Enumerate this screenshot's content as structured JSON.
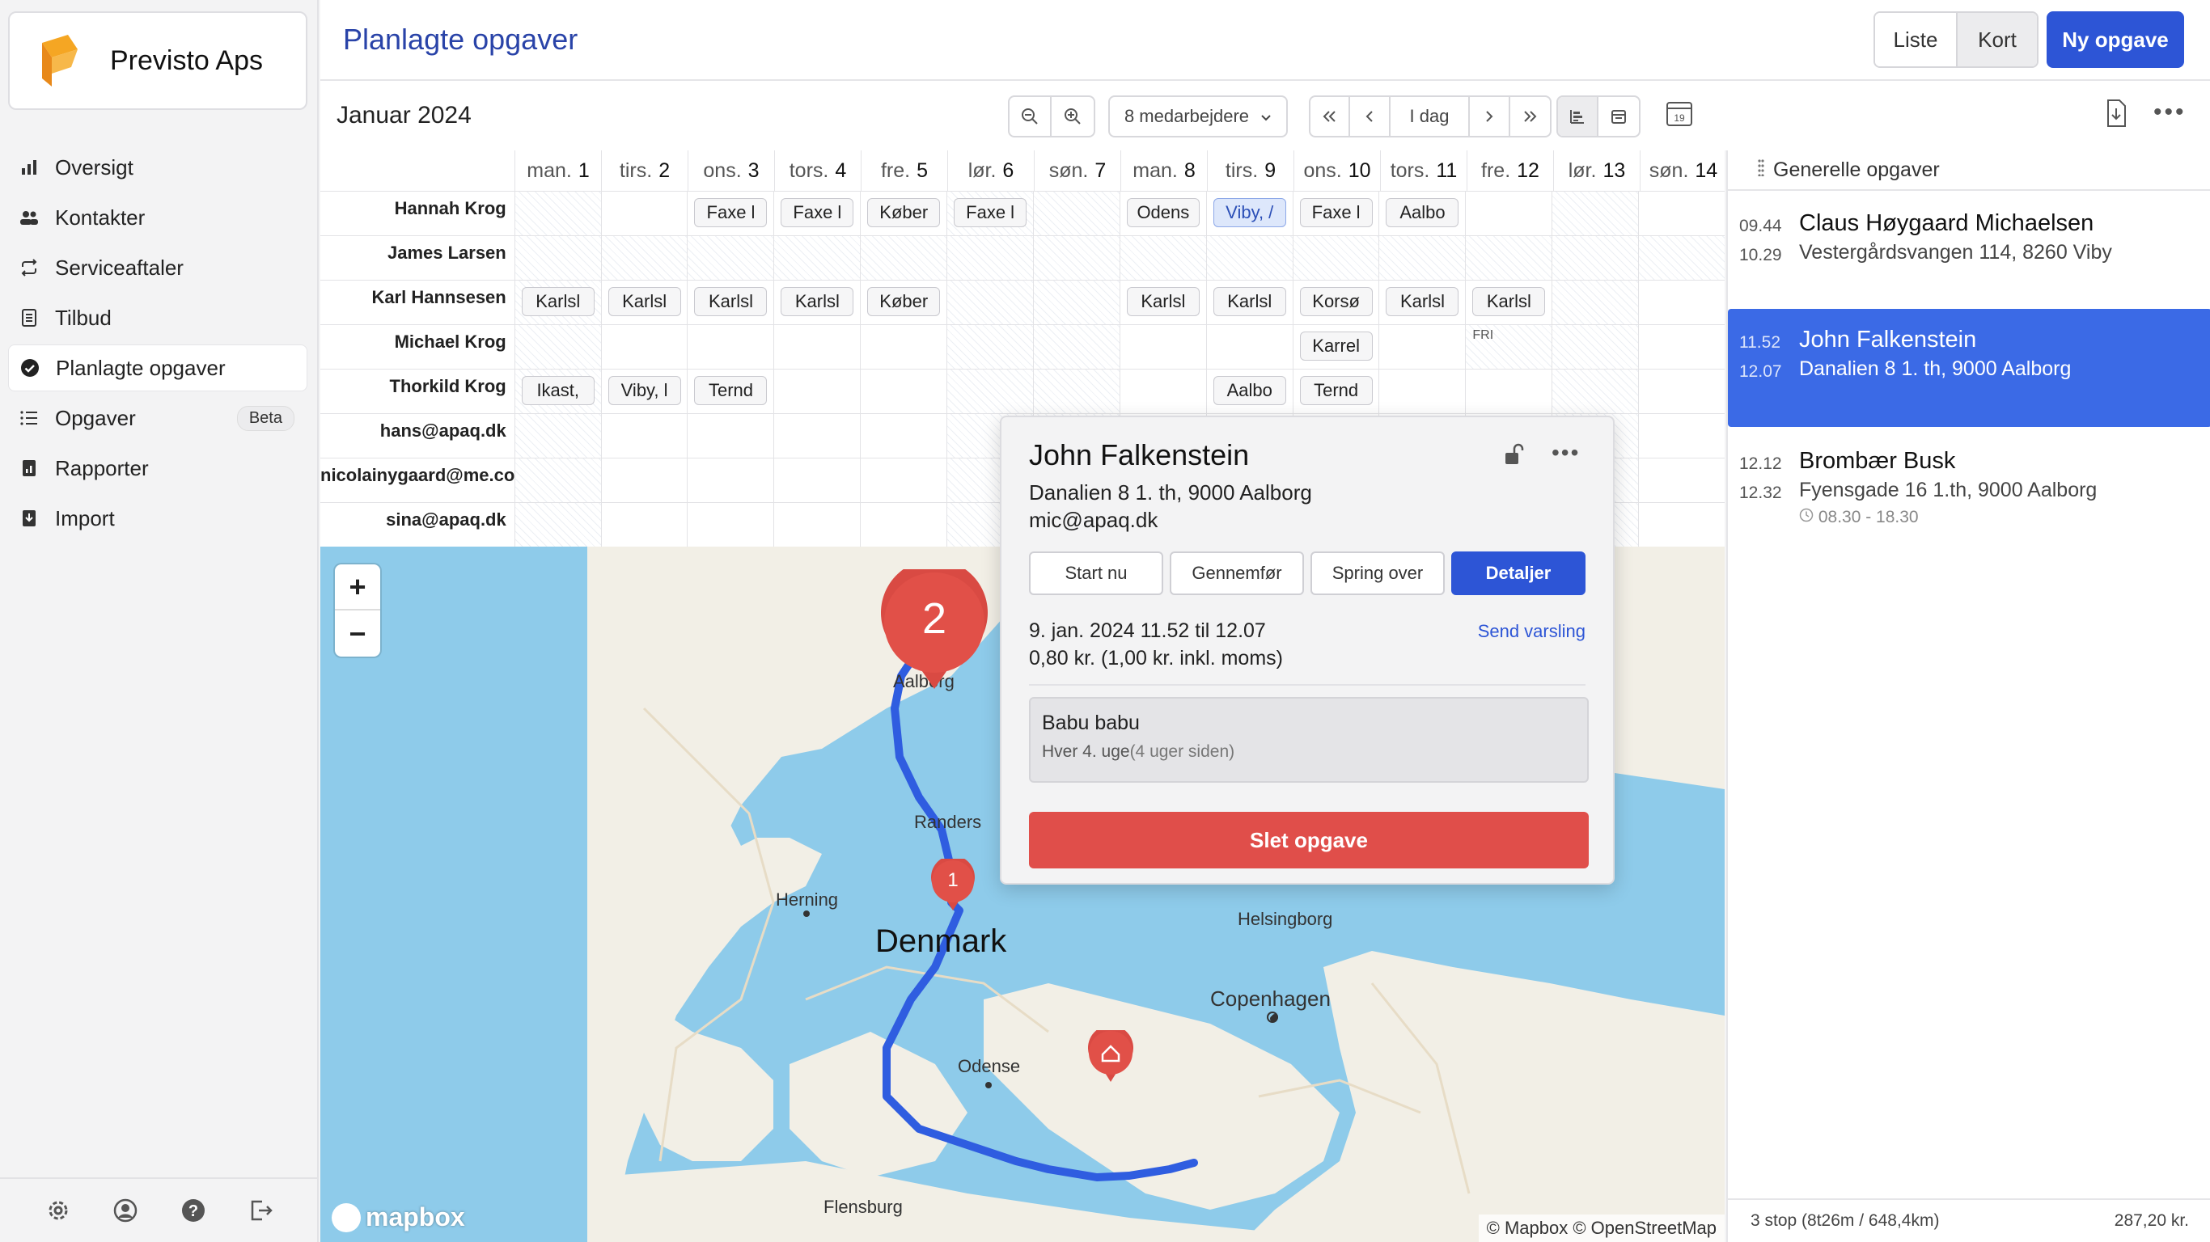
{
  "app": {
    "name": "Previsto Aps"
  },
  "sidebar": {
    "items": [
      {
        "label": "Oversigt",
        "icon": "bar-chart-icon"
      },
      {
        "label": "Kontakter",
        "icon": "users-icon"
      },
      {
        "label": "Serviceaftaler",
        "icon": "repeat-icon"
      },
      {
        "label": "Tilbud",
        "icon": "document-icon"
      },
      {
        "label": "Planlagte opgaver",
        "icon": "check-circle-icon",
        "active": true
      },
      {
        "label": "Opgaver",
        "icon": "list-icon",
        "badge": "Beta"
      },
      {
        "label": "Rapporter",
        "icon": "report-icon"
      },
      {
        "label": "Import",
        "icon": "import-icon"
      }
    ],
    "bottom_icons": [
      "settings-icon",
      "user-icon",
      "help-icon",
      "logout-icon"
    ]
  },
  "header": {
    "title": "Planlagte opgaver",
    "view_list": "Liste",
    "view_map": "Kort",
    "new_task": "Ny opgave"
  },
  "toolbar": {
    "month": "Januar 2024",
    "employees": "8 medarbejdere",
    "today": "I dag"
  },
  "calendar": {
    "days": [
      {
        "wd": "man.",
        "d": "1"
      },
      {
        "wd": "tirs.",
        "d": "2"
      },
      {
        "wd": "ons.",
        "d": "3"
      },
      {
        "wd": "tors.",
        "d": "4"
      },
      {
        "wd": "fre.",
        "d": "5"
      },
      {
        "wd": "lør.",
        "d": "6"
      },
      {
        "wd": "søn.",
        "d": "7"
      },
      {
        "wd": "man.",
        "d": "8"
      },
      {
        "wd": "tirs.",
        "d": "9"
      },
      {
        "wd": "ons.",
        "d": "10"
      },
      {
        "wd": "tors.",
        "d": "11"
      },
      {
        "wd": "fre.",
        "d": "12"
      },
      {
        "wd": "lør.",
        "d": "13"
      },
      {
        "wd": "søn.",
        "d": "14"
      }
    ],
    "rows": [
      {
        "name": "Hannah Krog",
        "cells": [
          "",
          "",
          "Faxe l",
          "Faxe l",
          "Køber",
          "Faxe l",
          "",
          "Odens",
          "Viby, /",
          "Faxe l",
          "Aalbo",
          "",
          "",
          ""
        ]
      },
      {
        "name": "James Larsen",
        "cells": [
          "",
          "",
          "",
          "",
          "",
          "",
          "",
          "",
          "",
          "",
          "",
          "",
          "",
          ""
        ]
      },
      {
        "name": "Karl Hannsesen",
        "cells": [
          "Karlsl",
          "Karlsl",
          "Karlsl",
          "Karlsl",
          "Køber",
          "",
          "",
          "Karlsl",
          "Karlsl",
          "Korsø",
          "Karlsl",
          "Karlsl",
          "",
          ""
        ]
      },
      {
        "name": "Michael Krog",
        "cells": [
          "",
          "",
          "",
          "",
          "",
          "",
          "",
          "",
          "",
          "Karrel",
          "",
          "",
          "",
          ""
        ]
      },
      {
        "name": "Thorkild Krog",
        "cells": [
          "Ikast,",
          "Viby, l",
          "Ternd",
          "",
          "",
          "",
          "",
          "",
          "Aalbo",
          "Ternd",
          "",
          "",
          "",
          ""
        ]
      },
      {
        "name": "hans@apaq.dk",
        "cells": [
          "",
          "",
          "",
          "",
          "",
          "",
          "",
          "",
          "",
          "",
          "",
          "",
          "",
          ""
        ]
      },
      {
        "name": "nicolainygaard@me.co",
        "cells": [
          "",
          "",
          "",
          "",
          "",
          "",
          "",
          "",
          "",
          "",
          "",
          "",
          "",
          ""
        ]
      },
      {
        "name": "sina@apaq.dk",
        "cells": [
          "",
          "",
          "",
          "",
          "",
          "",
          "",
          "",
          "",
          "",
          "",
          "",
          "",
          ""
        ]
      }
    ],
    "fri_label": "FRI"
  },
  "right_panel": {
    "title": "Generelle opgaver",
    "items": [
      {
        "start": "09.44",
        "end": "10.29",
        "name": "Claus Høygaard Michaelsen",
        "address": "Vestergårdsvangen 114, 8260 Viby"
      },
      {
        "start": "11.52",
        "end": "12.07",
        "name": "John Falkenstein",
        "address": "Danalien 8 1. th, 9000 Aalborg",
        "selected": true
      },
      {
        "start": "12.12",
        "end": "12.32",
        "name": "Brombær Busk",
        "address": "Fyensgade 16 1.th, 9000 Aalborg",
        "window": "08.30 - 18.30"
      }
    ],
    "footer_stats": "3 stop (8t26m / 648,4km)",
    "footer_total": "287,20 kr."
  },
  "map": {
    "labels": {
      "aalborg": "Aalborg",
      "randers": "Randers",
      "herning": "Herning",
      "denmark": "Denmark",
      "helsingborg": "Helsingborg",
      "copenhagen": "Copenhagen",
      "odense": "Odense",
      "flensburg": "Flensburg"
    },
    "marker_big": "2",
    "marker_small": "1",
    "attribution": "© Mapbox © OpenStreetMap",
    "logo": "mapbox",
    "zoom_in": "+",
    "zoom_out": "−"
  },
  "popup": {
    "name": "John Falkenstein",
    "address": "Danalien 8 1. th, 9000 Aalborg",
    "email": "mic@apaq.dk",
    "btn_start": "Start nu",
    "btn_complete": "Gennemfør",
    "btn_skip": "Spring over",
    "btn_details": "Detaljer",
    "date": "9. jan. 2024 11.52 til 12.07",
    "price": "0,80 kr. (1,00 kr. inkl. moms)",
    "send_notice": "Send varsling",
    "note_title": "Babu babu",
    "note_freq": "Hver 4. uge",
    "note_ago": "(4 uger siden)",
    "delete": "Slet opgave"
  },
  "colors": {
    "accent": "#2d55d6",
    "title": "#2943a8",
    "danger": "#e04e4a",
    "selected": "#3b6ae6",
    "logo": "#f5a623"
  }
}
